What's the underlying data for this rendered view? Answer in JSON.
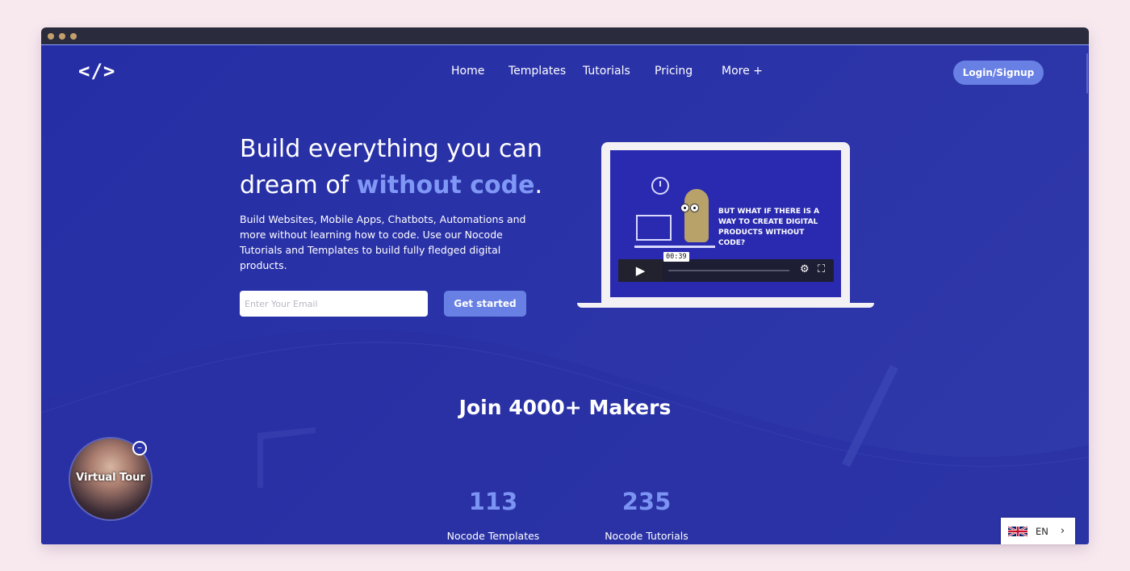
{
  "nav": {
    "logo": "</>",
    "items": [
      "Home",
      "Templates",
      "Tutorials",
      "Pricing",
      "More +"
    ],
    "login_label": "Login/Signup"
  },
  "hero": {
    "title_line1": "Build everything you can",
    "title_line2_start": "dream of ",
    "title_accent": "without code",
    "title_end": ".",
    "description": "Build Websites, Mobile Apps, Chatbots, Automations and more without learning how to code. Use our Nocode Tutorials and Templates to build fully fledged digital products.",
    "email_placeholder": "Enter Your Email",
    "cta_label": "Get started"
  },
  "video": {
    "caption": "But what if there is a way to create digital products without code?",
    "timestamp": "00:39",
    "play_icon": "play-icon",
    "settings_icon": "gear-icon",
    "fullscreen_icon": "fullscreen-icon"
  },
  "stats": {
    "heading": "Join 4000+ Makers",
    "items": [
      {
        "value": "113",
        "label": "Nocode Templates"
      },
      {
        "value": "235",
        "label": "Nocode Tutorials"
      }
    ]
  },
  "tour": {
    "label": "Virtual Tour",
    "minimize": "–"
  },
  "language": {
    "code": "EN",
    "chevron": "›",
    "flag_icon": "uk-flag-icon"
  },
  "colors": {
    "background": "#2b33a8",
    "accent": "#7f97f5",
    "button": "#6880e4",
    "page_bg": "#f8e9ef"
  }
}
